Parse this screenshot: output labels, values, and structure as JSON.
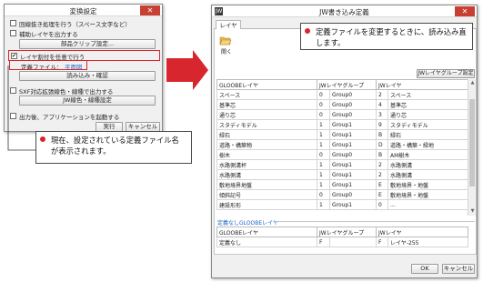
{
  "dialog1": {
    "title": "変換設定",
    "options": [
      {
        "label": "回線抜き処理を行う（スペース文字など）",
        "checked": false
      },
      {
        "label": "補助レイヤを出力する",
        "checked": false
      }
    ],
    "parts_button": "部品クリップ設定...",
    "layer_option": {
      "label": "レイヤ割付を任意で行う",
      "checked": true
    },
    "def_file_label": "定義ファイル：",
    "def_file_value": "平面図",
    "read_button": "読み込み・確認",
    "sxf_option": {
      "label": "SXF対応拡張線色・線種で出力する",
      "checked": false
    },
    "jw_button": "JW線色・線種設定",
    "launch_option": {
      "label": "出力後、アプリケーションを起動する",
      "checked": false
    },
    "run_button": "実行",
    "cancel_button": "キャンセル",
    "close_glyph": "✕",
    "check_glyph": "✔"
  },
  "callout1": {
    "text": "現在、設定されている定義ファイル名が表示されます。"
  },
  "dialog2": {
    "title": "JW書き込み定義",
    "app_icon": "JW",
    "tab": "レイヤ",
    "open_label": "開く",
    "group_settings_button": "JWレイヤグループ設定",
    "columns": [
      "GLOOBEレイヤ",
      "JWレイヤグループ",
      "JWレイヤ"
    ],
    "rows": [
      [
        "スペース",
        "0",
        "Group0",
        "2",
        "スペース"
      ],
      [
        "基準芯",
        "0",
        "Group0",
        "4",
        "基準芯"
      ],
      [
        "通り芯",
        "0",
        "Group0",
        "3",
        "通り芯"
      ],
      [
        "スタディモデル",
        "1",
        "Group1",
        "9",
        "スタディモデル"
      ],
      [
        "緑石",
        "1",
        "Group1",
        "B",
        "緑石"
      ],
      [
        "道路・構築物",
        "1",
        "Group1",
        "D",
        "道路・構築・緑地"
      ],
      [
        "樹木",
        "0",
        "Group0",
        "B",
        "AM樹木"
      ],
      [
        "水路側溝杯",
        "1",
        "Group1",
        "2",
        "水路側溝"
      ],
      [
        "水路側溝",
        "1",
        "Group1",
        "2",
        "水路側溝"
      ],
      [
        "敷地境界地盤",
        "1",
        "Group1",
        "E",
        "敷地境界・地盤"
      ],
      [
        "傾斜記号",
        "0",
        "Group0",
        "E",
        "敷地境界・地盤"
      ],
      [
        "建設形形",
        "1",
        "Group1",
        "0",
        "..."
      ]
    ],
    "undefined_title": "定義なしGLOOBEレイヤ",
    "undefined_columns": [
      "GLOOBEレイヤ",
      "JWレイヤグループ",
      "JWレイヤ"
    ],
    "undefined_row": [
      "定義なし",
      "F",
      "",
      "F",
      "レイヤ-255"
    ],
    "ok_button": "OK",
    "cancel_button": "キャンセル"
  },
  "callout2": {
    "text": "定義ファイルを変更するときに、読み込み直します。"
  },
  "colors": {
    "highlight": "#d8262f",
    "close": "#c84031"
  }
}
